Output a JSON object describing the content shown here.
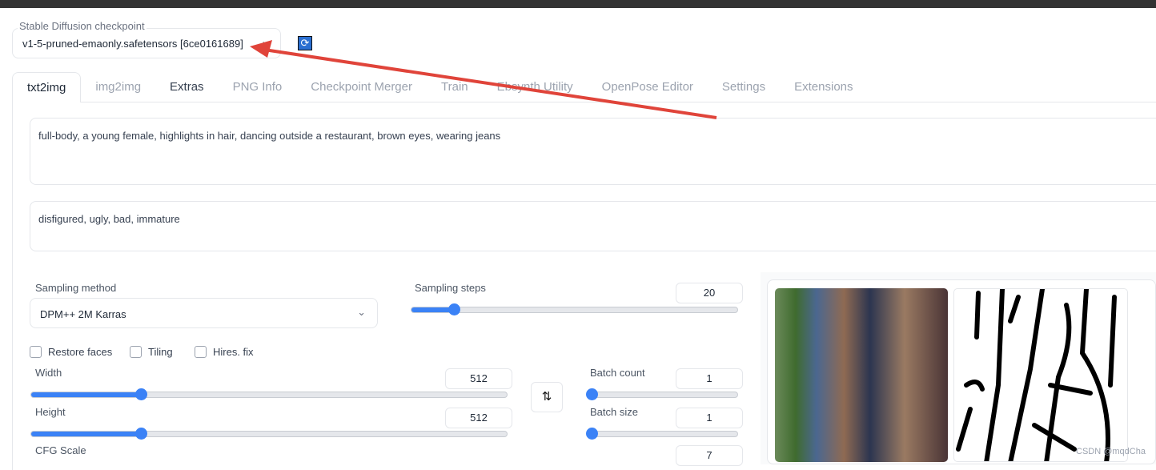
{
  "checkpoint": {
    "label": "Stable Diffusion checkpoint",
    "value": "v1-5-pruned-emaonly.safetensors [6ce0161689]"
  },
  "tabs": [
    {
      "label": "txt2img"
    },
    {
      "label": "img2img"
    },
    {
      "label": "Extras"
    },
    {
      "label": "PNG Info"
    },
    {
      "label": "Checkpoint Merger"
    },
    {
      "label": "Train"
    },
    {
      "label": "Ebsynth Utility"
    },
    {
      "label": "OpenPose Editor"
    },
    {
      "label": "Settings"
    },
    {
      "label": "Extensions"
    }
  ],
  "prompt": "full-body, a young female, highlights in hair, dancing outside a restaurant, brown eyes, wearing jeans",
  "negative_prompt": "disfigured, ugly, bad, immature",
  "sampling_method": {
    "label": "Sampling method",
    "value": "DPM++ 2M Karras"
  },
  "sampling_steps": {
    "label": "Sampling steps",
    "value": "20",
    "fraction": 0.13
  },
  "checkboxes": [
    {
      "label": "Restore faces",
      "checked": false
    },
    {
      "label": "Tiling",
      "checked": false
    },
    {
      "label": "Hires. fix",
      "checked": false
    }
  ],
  "width": {
    "label": "Width",
    "value": "512",
    "fraction": 0.23
  },
  "height": {
    "label": "Height",
    "value": "512",
    "fraction": 0.23
  },
  "batch_count": {
    "label": "Batch count",
    "value": "1",
    "fraction": 0
  },
  "batch_size": {
    "label": "Batch size",
    "value": "1",
    "fraction": 0
  },
  "cfg_scale": {
    "label": "CFG Scale",
    "value": "7"
  },
  "swap_icon": "swap-vertical-icon",
  "watermark": "CSDN @mqdCha",
  "colors": {
    "accent": "#3b82f6",
    "arrow": "#e0443a"
  }
}
